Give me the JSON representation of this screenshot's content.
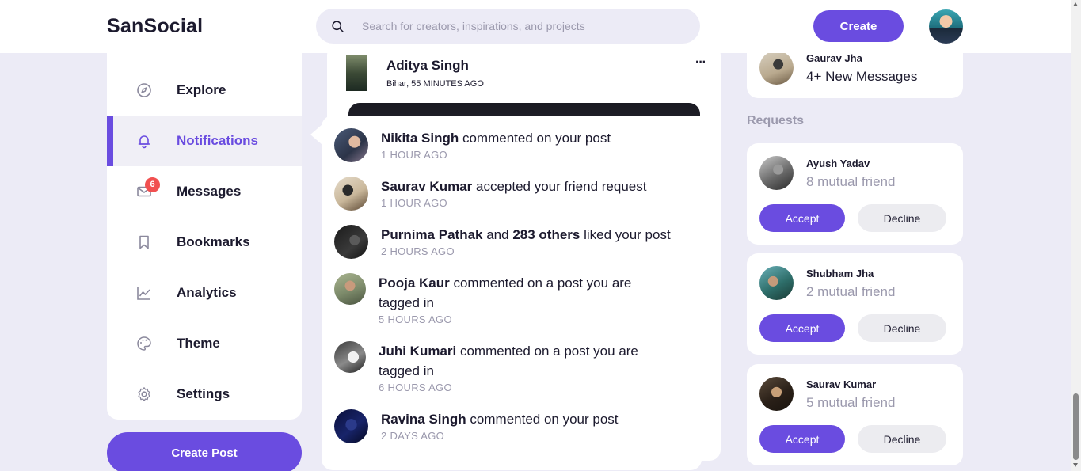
{
  "app": {
    "logo": "SanSocial"
  },
  "search": {
    "placeholder": "Search for creators, inspirations, and projects",
    "icon": "search-icon"
  },
  "header": {
    "create_label": "Create"
  },
  "sidebar": {
    "items": [
      {
        "label": "Explore",
        "icon": "compass-icon"
      },
      {
        "label": "Notifications",
        "icon": "bell-icon",
        "active": true
      },
      {
        "label": "Messages",
        "icon": "mail-icon",
        "badge": "6"
      },
      {
        "label": "Bookmarks",
        "icon": "bookmark-icon"
      },
      {
        "label": "Analytics",
        "icon": "chart-icon"
      },
      {
        "label": "Theme",
        "icon": "palette-icon"
      },
      {
        "label": "Settings",
        "icon": "gear-icon"
      }
    ],
    "create_post_label": "Create Post"
  },
  "feed": {
    "post": {
      "author": "Aditya Singh",
      "meta": "Bihar, 55 MINUTES AGO",
      "more": "···"
    }
  },
  "notifications": [
    {
      "name": "Nikita Singh",
      "text": " commented on your post",
      "time": "1 HOUR AGO"
    },
    {
      "name": "Saurav Kumar",
      "text": " accepted your friend request",
      "time": "1 HOUR AGO"
    },
    {
      "name": "Purnima Pathak",
      "mid": " and ",
      "name2": "283 others",
      "text": " liked your post",
      "time": "2 HOURS AGO"
    },
    {
      "name": "Pooja Kaur",
      "text": " commented on a post you are tagged in",
      "time": "5 HOURS AGO"
    },
    {
      "name": "Juhi Kumari",
      "text": " commented on a post you are tagged in",
      "time": "6 HOURS AGO"
    },
    {
      "name": "Ravina Singh",
      "text": " commented on your post",
      "time": "2 DAYS AGO"
    }
  ],
  "messages_card": {
    "name": "Gaurav Jha",
    "text": "4+ New Messages"
  },
  "requests": {
    "title": "Requests",
    "items": [
      {
        "name": "Ayush Yadav",
        "mutual": "8 mutual friend",
        "accept": "Accept",
        "decline": "Decline"
      },
      {
        "name": "Shubham Jha",
        "mutual": "2 mutual friend",
        "accept": "Accept",
        "decline": "Decline"
      },
      {
        "name": "Saurav Kumar",
        "mutual": "5 mutual friend",
        "accept": "Accept",
        "decline": "Decline"
      }
    ]
  },
  "colors": {
    "accent": "#6a4ce0",
    "badge": "#f15050",
    "muted": "#9b99ad",
    "background": "#ecebf6"
  }
}
